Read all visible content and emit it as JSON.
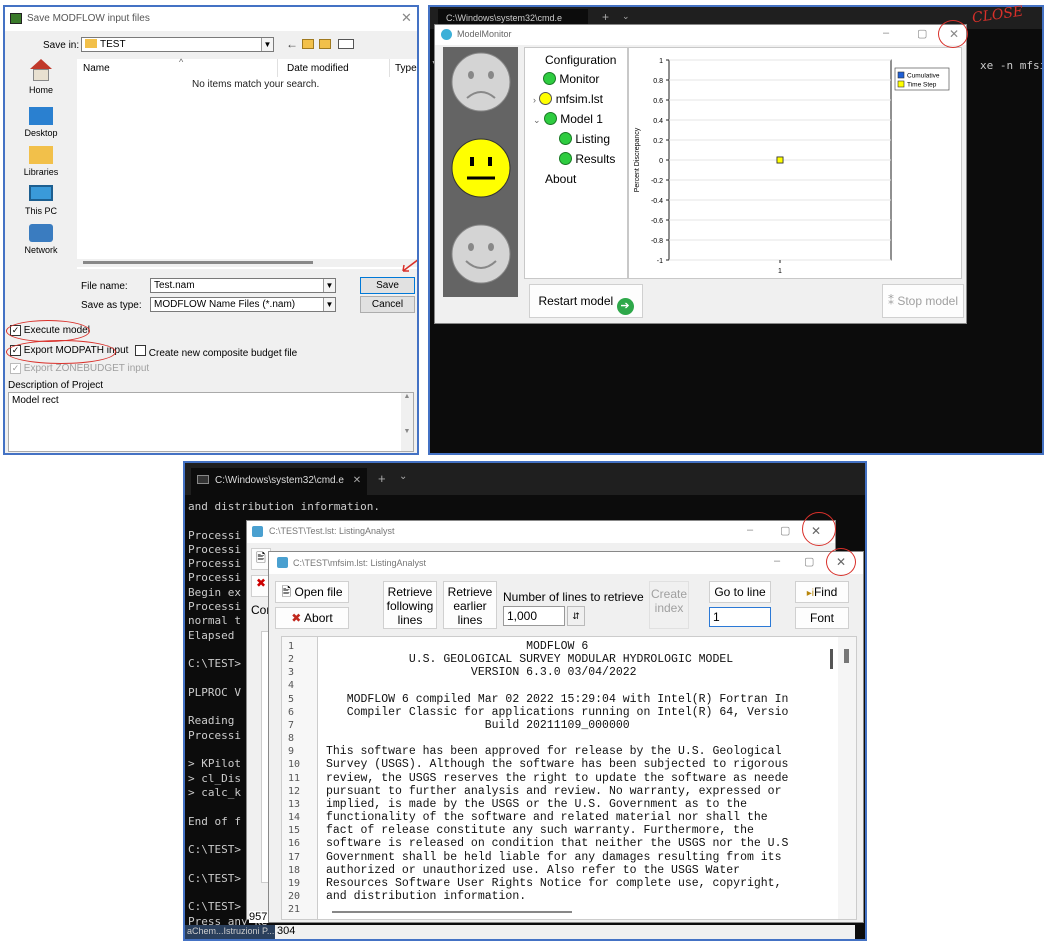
{
  "save_dialog": {
    "title": "Save MODFLOW input files",
    "save_in_label": "Save in:",
    "save_in_value": "TEST",
    "columns": [
      "Name",
      "Date modified",
      "Type"
    ],
    "empty_message": "No items match your search.",
    "nav": [
      "Home",
      "Desktop",
      "Libraries",
      "This PC",
      "Network"
    ],
    "file_name_label": "File name:",
    "file_name_value": "Test.nam",
    "save_as_label": "Save as type:",
    "save_as_value": "MODFLOW Name Files (*.nam)",
    "save_button": "Save",
    "cancel_button": "Cancel",
    "execute_model": "Execute model",
    "export_modpath": "Export MODPATH input",
    "composite_budget": "Create new composite budget file",
    "export_zonebudget": "Export ZONEBUDGET input",
    "description_label": "Description of Project",
    "description_value": "Model rect"
  },
  "cmd_top": {
    "tab_title": "C:\\Windows\\system32\\cmd.e",
    "command_fragment": "xe -n mfsim."
  },
  "model_monitor": {
    "title": "ModelMonitor",
    "tree": [
      "Configuration",
      "Monitor",
      "mfsim.lst",
      "Model 1",
      "Listing",
      "Results",
      "About"
    ],
    "restart_button": "Restart model",
    "stop_button": "Stop model",
    "close_annotation": "CLOSE"
  },
  "chart_data": {
    "type": "scatter",
    "ylabel": "Percent Discrepancy",
    "xlabel": "",
    "ylim": [
      -1,
      1
    ],
    "yticks": [
      "1",
      "0.8",
      "0.6",
      "0.4",
      "0.2",
      "0",
      "-0.2",
      "-0.4",
      "-0.6",
      "-0.8",
      "-1"
    ],
    "xticks": [
      "1"
    ],
    "series": [
      {
        "name": "Cumulative",
        "color": "#1f5fd6",
        "x": [
          1
        ],
        "y": [
          0
        ]
      },
      {
        "name": "Time Step",
        "color": "#ffff00",
        "x": [
          1
        ],
        "y": [
          0
        ]
      }
    ],
    "legend": "top-right",
    "grid": true
  },
  "cmd_bottom": {
    "tab_title": "C:\\Windows\\system32\\cmd.e",
    "lines": [
      "and distribution information.",
      "",
      "Processi",
      "Processi",
      "Processi",
      "Processi",
      "Begin ex",
      "Processi",
      "normal t",
      "Elapsed ",
      "",
      "C:\\TEST>",
      "",
      "PLPROC V",
      "",
      "Reading ",
      "Processi",
      "",
      "> KPilot",
      "> cl_Dis",
      "> calc_k",
      "",
      "End of f",
      "",
      "C:\\TEST>",
      "",
      "C:\\TEST>",
      "",
      "C:\\TEST>",
      "Press any ke"
    ],
    "status_left": "aChem...Istruzioni P...",
    "status_value": "304",
    "status_value2": "957"
  },
  "listing_back": {
    "title": "C:\\TEST\\Test.lst: ListingAnalyst",
    "left_button": "Cor"
  },
  "listing_front": {
    "title": "C:\\TEST\\mfsim.lst: ListingAnalyst",
    "open_file": "Open file",
    "abort": "Abort",
    "retrieve_following": "Retrieve following lines",
    "retrieve_earlier": "Retrieve earlier lines",
    "num_lines_label": "Number of lines to retrieve",
    "num_lines_value": "1,000",
    "create_index": "Create index",
    "go_to_line": "Go to line",
    "go_to_line_value": "1",
    "find": "Find",
    "font": "Font",
    "lines": [
      "                             MODFLOW 6",
      "            U.S. GEOLOGICAL SURVEY MODULAR HYDROLOGIC MODEL",
      "                     VERSION 6.3.0 03/04/2022",
      "",
      "   MODFLOW 6 compiled Mar 02 2022 15:29:04 with Intel(R) Fortran In",
      "   Compiler Classic for applications running on Intel(R) 64, Versio",
      "                       Build 20211109_000000",
      "",
      "This software has been approved for release by the U.S. Geological",
      "Survey (USGS). Although the software has been subjected to rigorous",
      "review, the USGS reserves the right to update the software as neede",
      "pursuant to further analysis and review. No warranty, expressed or",
      "implied, is made by the USGS or the U.S. Government as to the",
      "functionality of the software and related material nor shall the",
      "fact of release constitute any such warranty. Furthermore, the",
      "software is released on condition that neither the USGS nor the U.S",
      "Government shall be held liable for any damages resulting from its",
      "authorized or unauthorized use. Also refer to the USGS Water",
      "Resources Software User Rights Notice for complete use, copyright,",
      "and distribution information.",
      ""
    ]
  }
}
